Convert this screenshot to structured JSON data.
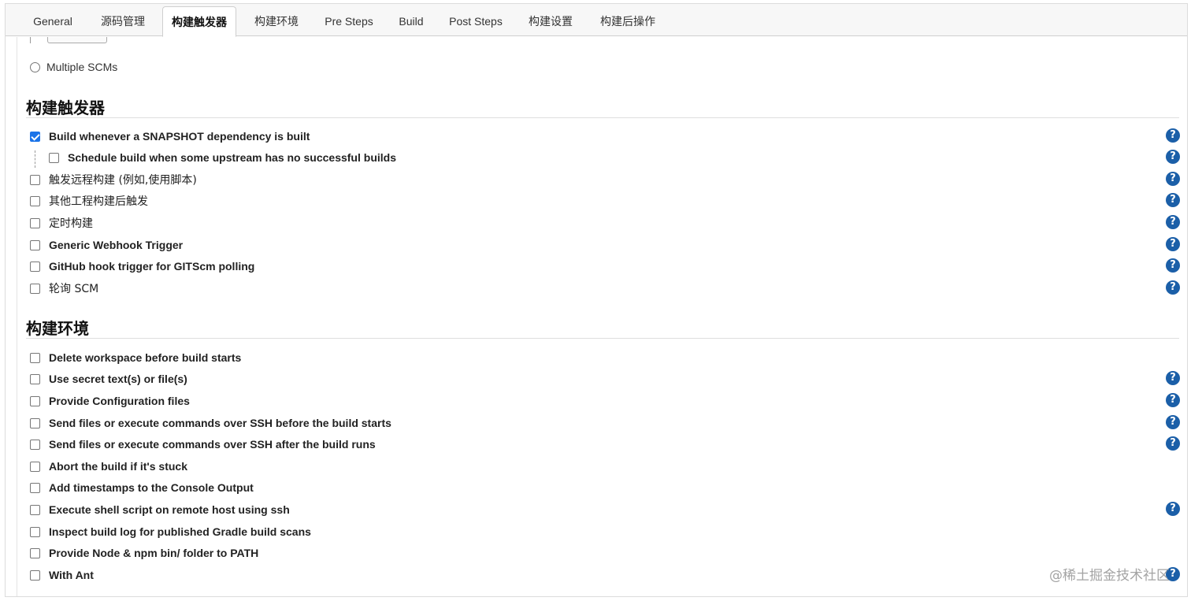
{
  "tabs": [
    {
      "label": "General",
      "active": false
    },
    {
      "label": "源码管理",
      "active": false
    },
    {
      "label": "构建触发器",
      "active": true
    },
    {
      "label": "构建环境",
      "active": false
    },
    {
      "label": "Pre Steps",
      "active": false
    },
    {
      "label": "Build",
      "active": false
    },
    {
      "label": "Post Steps",
      "active": false
    },
    {
      "label": "构建设置",
      "active": false
    },
    {
      "label": "构建后操作",
      "active": false
    }
  ],
  "scm": {
    "multiple_scms_label": "Multiple SCMs"
  },
  "triggers": {
    "title": "构建触发器",
    "options": [
      {
        "label": "Build whenever a SNAPSHOT dependency is built",
        "checked": true,
        "help": true
      },
      {
        "label": "Schedule build when some upstream has no successful builds",
        "checked": false,
        "help": true
      },
      {
        "label": "触发远程构建 (例如,使用脚本)",
        "checked": false,
        "help": true
      },
      {
        "label": "其他工程构建后触发",
        "checked": false,
        "help": true
      },
      {
        "label": "定时构建",
        "checked": false,
        "help": true
      },
      {
        "label": "Generic Webhook Trigger",
        "checked": false,
        "help": true
      },
      {
        "label": "GitHub hook trigger for GITScm polling",
        "checked": false,
        "help": true
      },
      {
        "label": "轮询 SCM",
        "checked": false,
        "help": true
      }
    ]
  },
  "environment": {
    "title": "构建环境",
    "options": [
      {
        "label": "Delete workspace before build starts",
        "checked": false,
        "help": false
      },
      {
        "label": "Use secret text(s) or file(s)",
        "checked": false,
        "help": true
      },
      {
        "label": "Provide Configuration files",
        "checked": false,
        "help": true
      },
      {
        "label": "Send files or execute commands over SSH before the build starts",
        "checked": false,
        "help": true
      },
      {
        "label": "Send files or execute commands over SSH after the build runs",
        "checked": false,
        "help": true
      },
      {
        "label": "Abort the build if it's stuck",
        "checked": false,
        "help": false
      },
      {
        "label": "Add timestamps to the Console Output",
        "checked": false,
        "help": false
      },
      {
        "label": "Execute shell script on remote host using ssh",
        "checked": false,
        "help": true
      },
      {
        "label": "Inspect build log for published Gradle build scans",
        "checked": false,
        "help": false
      },
      {
        "label": "Provide Node & npm bin/ folder to PATH",
        "checked": false,
        "help": false
      },
      {
        "label": "With Ant",
        "checked": false,
        "help": true
      }
    ]
  },
  "help_glyph": "?",
  "watermark": "@稀土掘金技术社区",
  "colors": {
    "help_icon": "#1b5fa8",
    "checkbox_checked": "#1a73e8",
    "tab_bar": "#f7f7f7"
  }
}
